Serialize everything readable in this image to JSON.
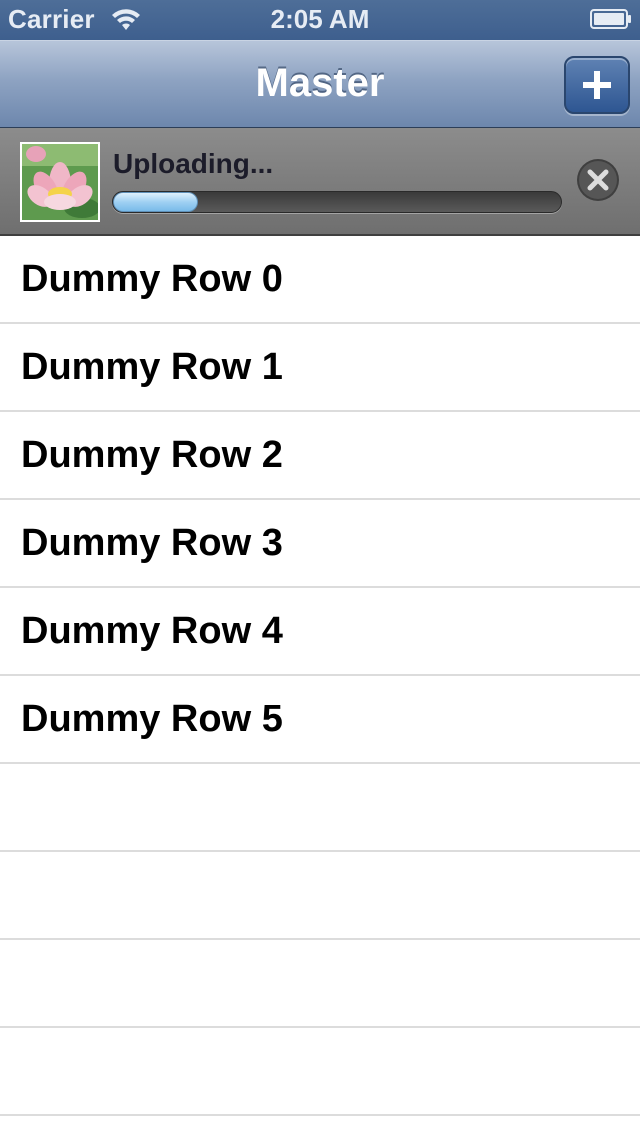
{
  "status_bar": {
    "carrier": "Carrier",
    "time": "2:05 AM",
    "icons": [
      "wifi-icon",
      "battery-icon"
    ]
  },
  "nav_bar": {
    "title": "Master",
    "add_button_label": "+",
    "tint_color": "#6d87ad"
  },
  "upload": {
    "status_text": "Uploading...",
    "progress": 0.19,
    "thumbnail": "lotus-flower-image",
    "cancel_icon": "close-icon",
    "fill_color": "#9fd0f3"
  },
  "table": {
    "rows": [
      {
        "label": "Dummy Row 0"
      },
      {
        "label": "Dummy Row 1"
      },
      {
        "label": "Dummy Row 2"
      },
      {
        "label": "Dummy Row 3"
      },
      {
        "label": "Dummy Row 4"
      },
      {
        "label": "Dummy Row 5"
      }
    ]
  }
}
